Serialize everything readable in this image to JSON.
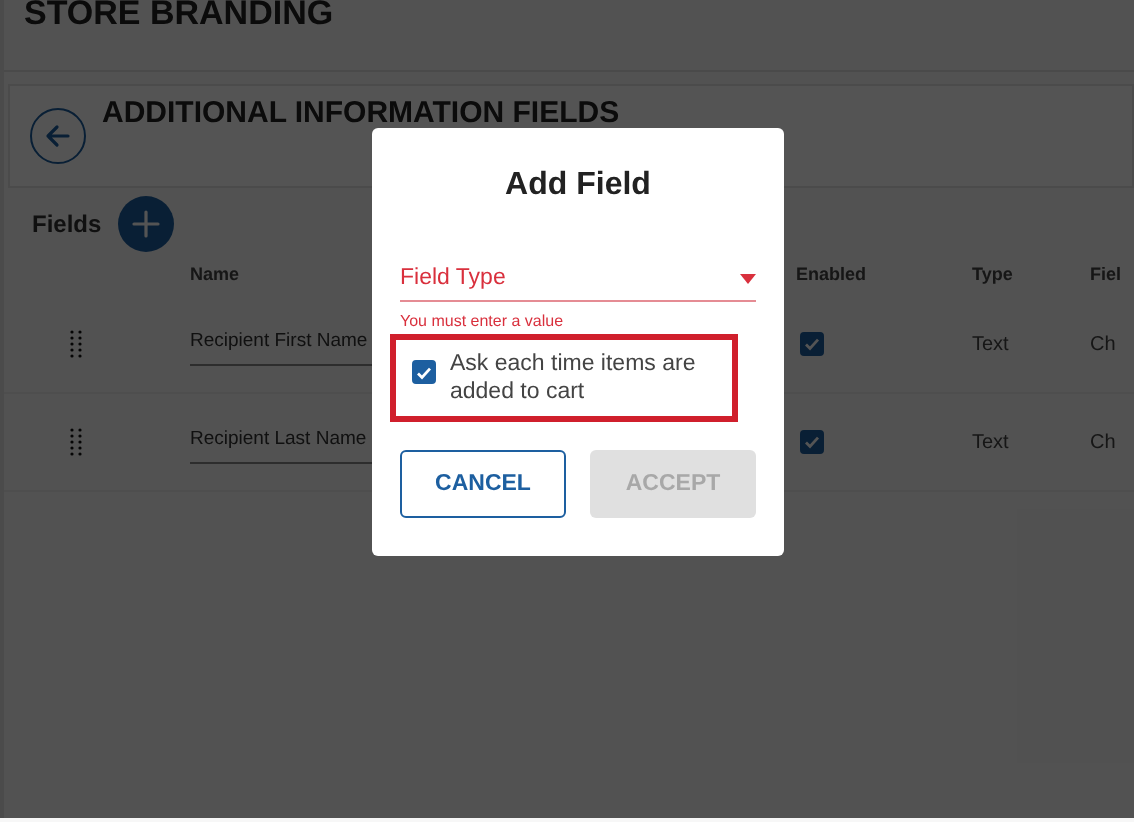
{
  "page": {
    "title": "STORE BRANDING"
  },
  "section": {
    "title": "ADDITIONAL INFORMATION FIELDS"
  },
  "fields_header": {
    "label": "Fields"
  },
  "table": {
    "columns": [
      "Name",
      "Enabled",
      "Type",
      "Fiel"
    ],
    "rows": [
      {
        "name": "Recipient First Name",
        "enabled": true,
        "type": "Text",
        "column_4": "Ch"
      },
      {
        "name": "Recipient Last Name",
        "enabled": true,
        "type": "Text",
        "column_4": "Ch"
      }
    ]
  },
  "dialog": {
    "title": "Add Field",
    "select": {
      "label": "Field Type",
      "error": "You must enter a value",
      "invalid": true
    },
    "checkbox": {
      "label": "Ask each time items are added to cart",
      "checked": true,
      "highlighted": true
    },
    "buttons": [
      {
        "label": "CANCEL",
        "kind": "outlined",
        "disabled": false
      },
      {
        "label": "ACCEPT",
        "kind": "filled",
        "disabled": true
      }
    ]
  }
}
